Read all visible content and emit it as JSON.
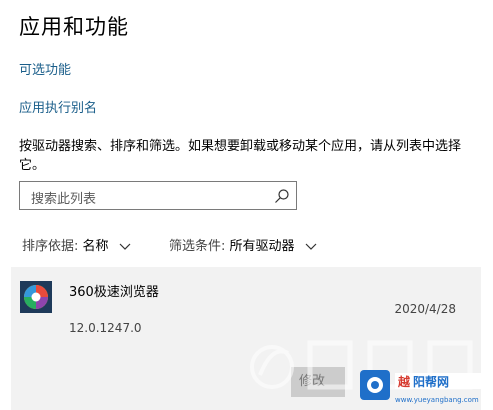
{
  "page": {
    "title": "应用和功能",
    "optional_features_link": "可选功能",
    "app_alias_link": "应用执行别名",
    "description": "按驱动器搜索、排序和筛选。如果想要卸载或移动某个应用，请从列表中选择它。"
  },
  "search": {
    "placeholder": "搜索此列表"
  },
  "filters": {
    "sort_label": "排序依据:",
    "sort_value": "名称",
    "filter_label": "筛选条件:",
    "filter_value": "所有驱动器"
  },
  "apps": [
    {
      "name": "360极速浏览器",
      "date": "2020/4/28",
      "version": "12.0.1247.0",
      "modify_label": "修改"
    }
  ],
  "watermark": {
    "site": "www.yueyangbang.com"
  },
  "colors": {
    "link": "#1a5e8a",
    "card_bg": "#f2f2f2",
    "icon_bg": "#1e3a5a"
  }
}
